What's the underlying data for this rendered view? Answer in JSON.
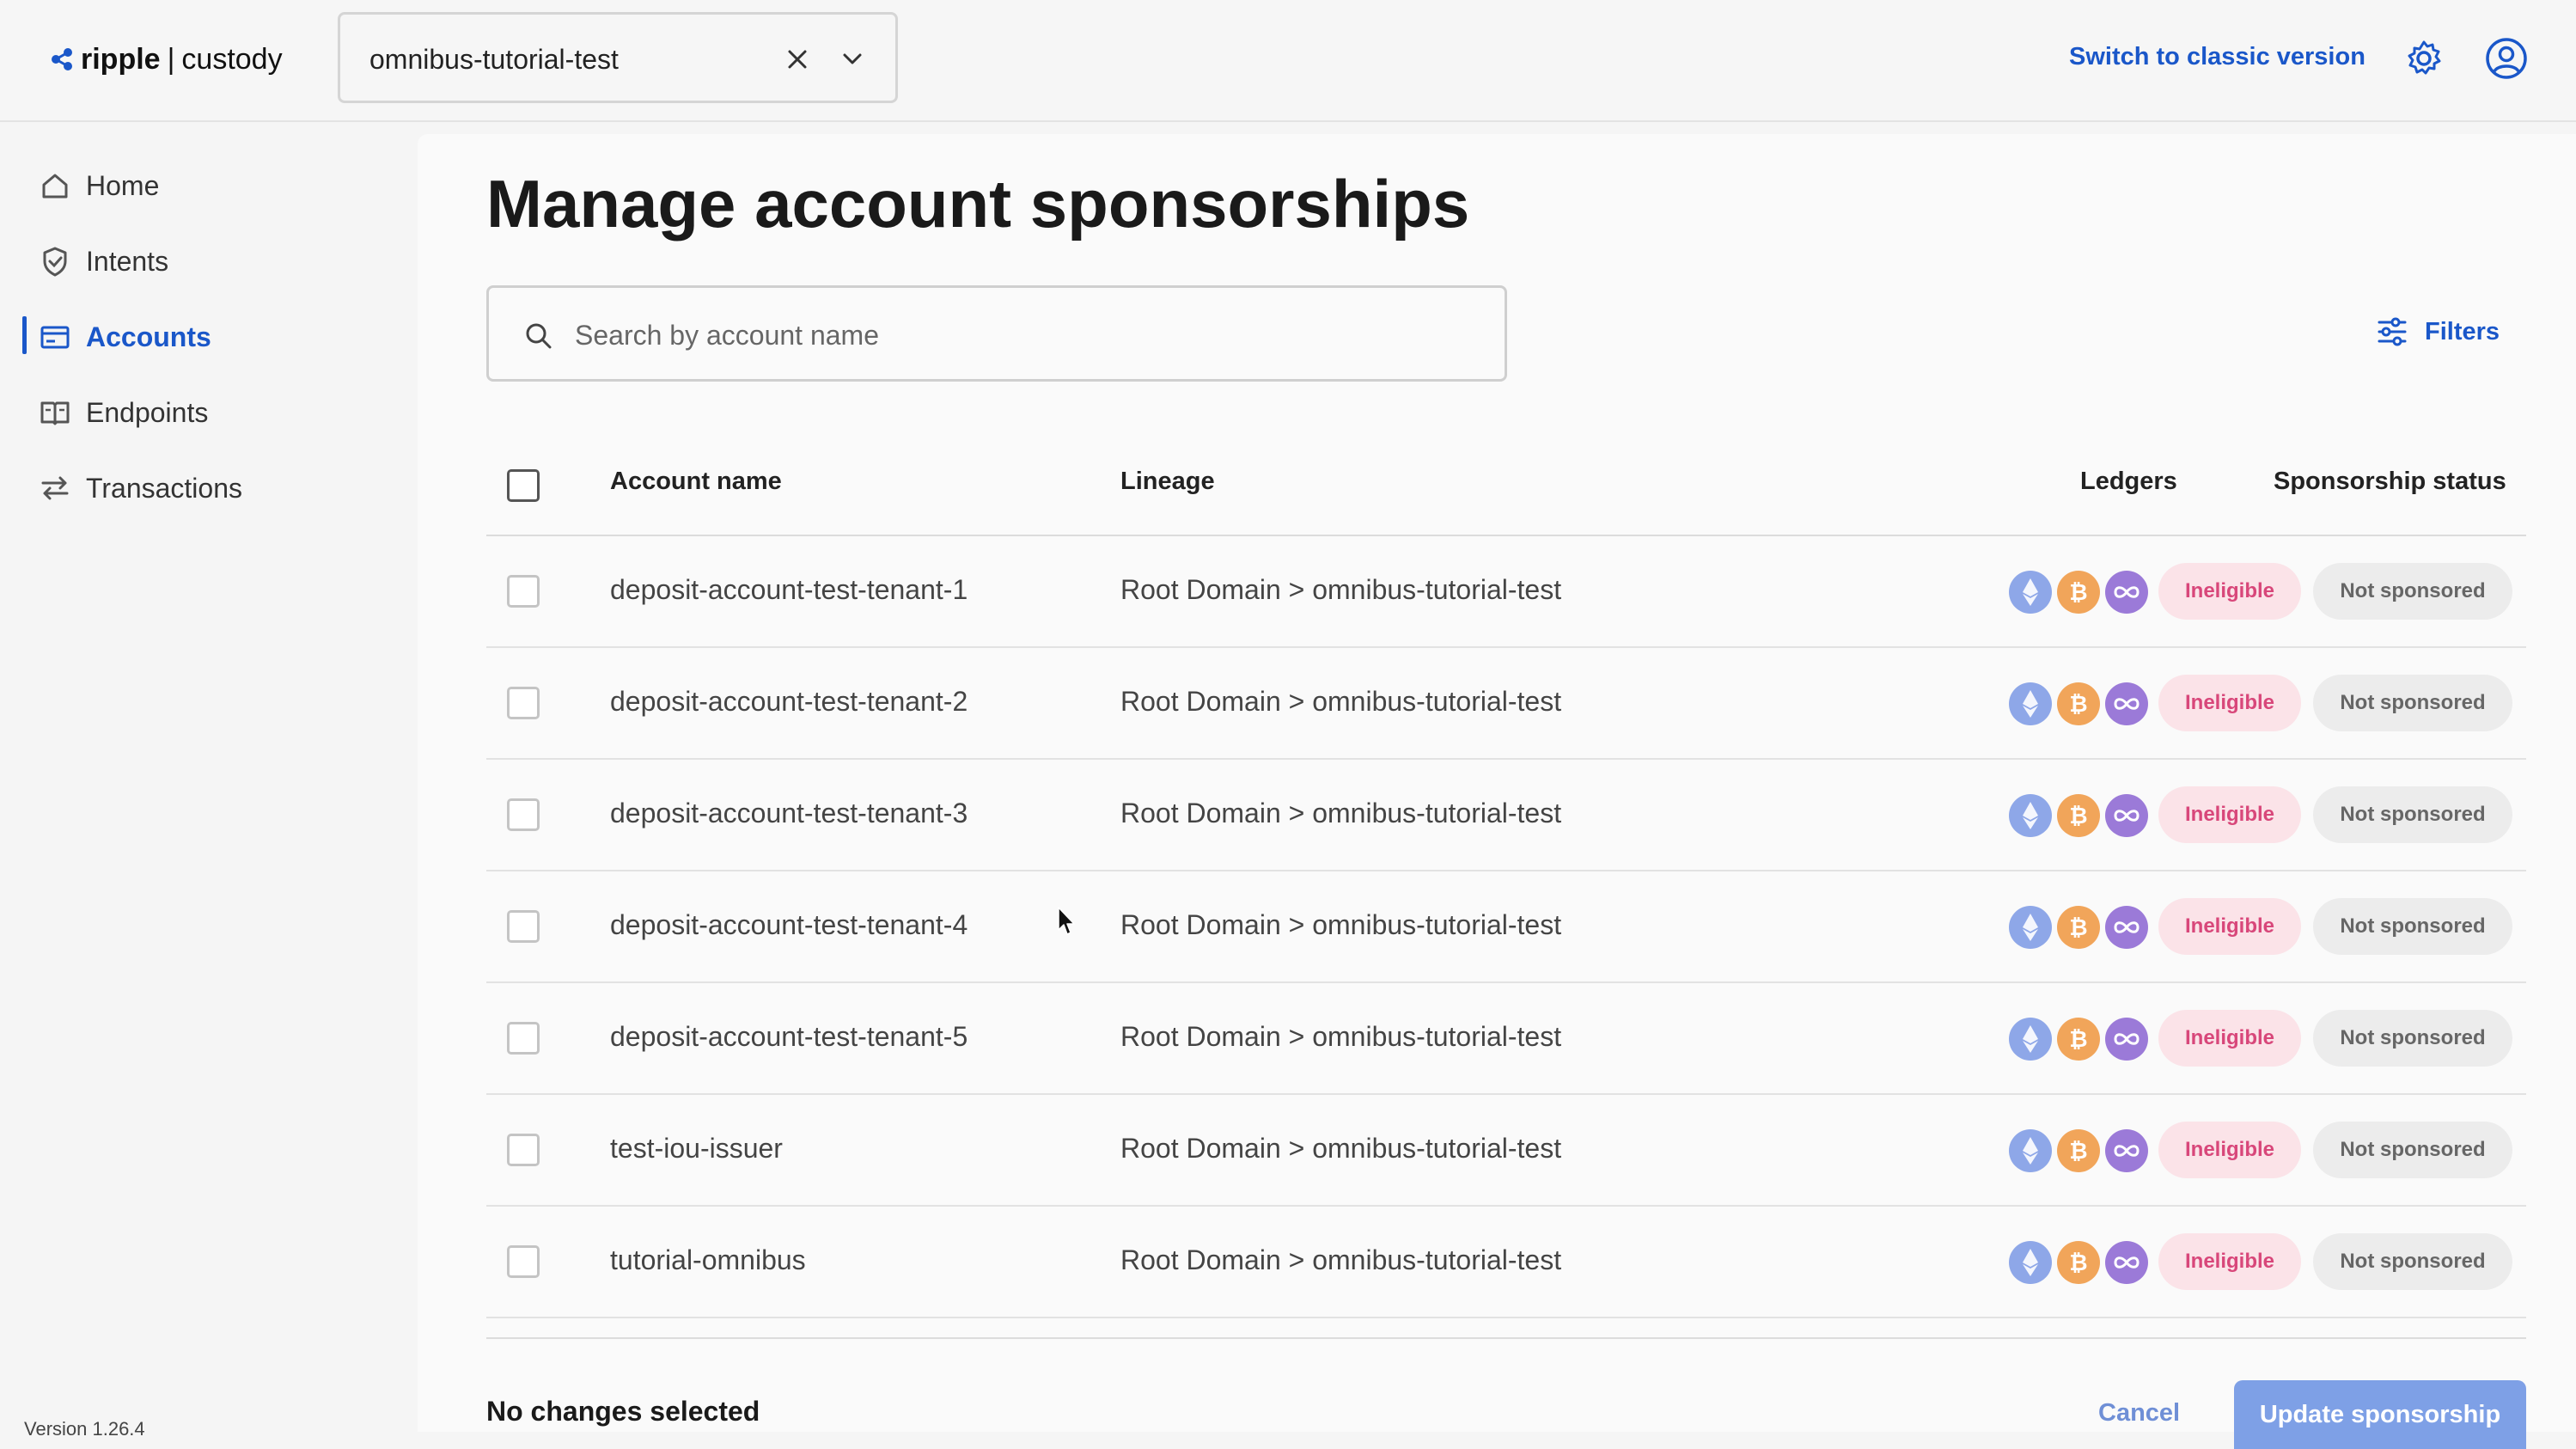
{
  "app": {
    "logo_name": "ripple",
    "logo_sep": "|",
    "logo_sub": "custody"
  },
  "header": {
    "tenant_value": "omnibus-tutorial-test",
    "switch_label": "Switch to classic version",
    "icons": [
      "close-icon",
      "chevron-down-icon",
      "gear-icon",
      "user-icon"
    ]
  },
  "sidebar": {
    "items": [
      {
        "label": "Home",
        "icon": "home-icon",
        "active": false
      },
      {
        "label": "Intents",
        "icon": "shield-check-icon",
        "active": false
      },
      {
        "label": "Accounts",
        "icon": "wallet-icon",
        "active": true
      },
      {
        "label": "Endpoints",
        "icon": "book-icon",
        "active": false
      },
      {
        "label": "Transactions",
        "icon": "transfer-icon",
        "active": false
      }
    ],
    "version": "Version 1.26.4"
  },
  "page": {
    "title": "Manage account sponsorships",
    "search_placeholder": "Search by account name",
    "filters_label": "Filters"
  },
  "table": {
    "headers": {
      "account_name": "Account name",
      "lineage": "Lineage",
      "ledgers": "Ledgers",
      "sponsorship_status": "Sponsorship status"
    },
    "rows": [
      {
        "name": "deposit-account-test-tenant-1",
        "lineage": "Root Domain > omnibus-tutorial-test",
        "eligibility": "Ineligible",
        "status": "Not sponsored"
      },
      {
        "name": "deposit-account-test-tenant-2",
        "lineage": "Root Domain > omnibus-tutorial-test",
        "eligibility": "Ineligible",
        "status": "Not sponsored"
      },
      {
        "name": "deposit-account-test-tenant-3",
        "lineage": "Root Domain > omnibus-tutorial-test",
        "eligibility": "Ineligible",
        "status": "Not sponsored"
      },
      {
        "name": "deposit-account-test-tenant-4",
        "lineage": "Root Domain > omnibus-tutorial-test",
        "eligibility": "Ineligible",
        "status": "Not sponsored"
      },
      {
        "name": "deposit-account-test-tenant-5",
        "lineage": "Root Domain > omnibus-tutorial-test",
        "eligibility": "Ineligible",
        "status": "Not sponsored"
      },
      {
        "name": "test-iou-issuer",
        "lineage": "Root Domain > omnibus-tutorial-test",
        "eligibility": "Ineligible",
        "status": "Not sponsored"
      },
      {
        "name": "tutorial-omnibus",
        "lineage": "Root Domain > omnibus-tutorial-test",
        "eligibility": "Ineligible",
        "status": "Not sponsored"
      }
    ],
    "ledger_icons": [
      "ethereum-icon",
      "bitcoin-icon",
      "tezos-icon"
    ]
  },
  "footer": {
    "status": "No changes selected",
    "cancel_label": "Cancel",
    "update_label": "Update sponsorship"
  },
  "colors": {
    "accent": "#1a57c9",
    "ineligible_bg": "#fbe3e8",
    "ineligible_text": "#d8477a",
    "eth": "#8ea7e8",
    "btc": "#f1a55a",
    "xtz": "#9b7ad8"
  }
}
